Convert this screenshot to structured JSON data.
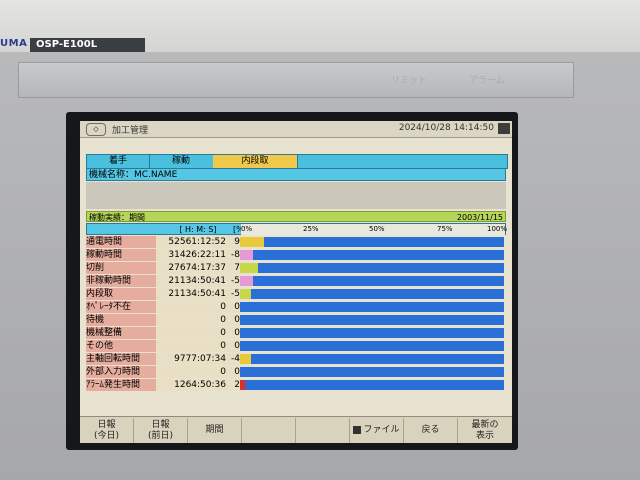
{
  "bezel": {
    "brand": "UMA",
    "model": "OSP-E100L",
    "leds": [
      "",
      "",
      "",
      "",
      "リミット",
      "アラーム"
    ]
  },
  "screen": {
    "title": "加工管理",
    "datetime": "2024/10/28 14:14:50",
    "tabs": [
      "着手",
      "稼動",
      "内段取"
    ],
    "machine_label": "機械名称：MC.NAME",
    "section_title": "稼動実績：期間",
    "section_date": "2003/11/15",
    "col_hms": "[ H: M: S]",
    "col_pct": "[%]",
    "ticks": [
      "0%",
      "25%",
      "50%",
      "75%",
      "100%"
    ],
    "rows": [
      {
        "label": "通電時間",
        "time": "52561:12:52",
        "pct": "9",
        "fill": 9,
        "color": "#e8c93a"
      },
      {
        "label": "稼動時間",
        "time": "31426:22:11",
        "pct": "-8",
        "fill": 5,
        "color": "#e59ad6"
      },
      {
        "label": "切削",
        "time": "27674:17:37",
        "pct": "7",
        "fill": 7,
        "color": "#c6d84a"
      },
      {
        "label": "非稼動時間",
        "time": "21134:50:41",
        "pct": "-5",
        "fill": 5,
        "color": "#e59ad6"
      },
      {
        "label": "内段取",
        "time": "21134:50:41",
        "pct": "-5",
        "fill": 4,
        "color": "#c6d84a"
      },
      {
        "label": "ｵﾍﾟﾚｰﾀ不在",
        "time": "0",
        "pct": "0",
        "fill": 0,
        "color": "#2a6ed7"
      },
      {
        "label": "待機",
        "time": "0",
        "pct": "0",
        "fill": 0,
        "color": "#2a6ed7"
      },
      {
        "label": "機械整備",
        "time": "0",
        "pct": "0",
        "fill": 0,
        "color": "#2a6ed7"
      },
      {
        "label": "その他",
        "time": "0",
        "pct": "0",
        "fill": 0,
        "color": "#2a6ed7"
      },
      {
        "label": "主軸回転時間",
        "time": "9777:07:34",
        "pct": "-4",
        "fill": 4,
        "color": "#e8c93a"
      },
      {
        "label": "外部入力時間",
        "time": "0",
        "pct": "0",
        "fill": 0,
        "color": "#2a6ed7"
      },
      {
        "label": "ｱﾗｰﾑ発生時間",
        "time": "1264:50:36",
        "pct": "2",
        "fill": 2,
        "color": "#d9302a"
      }
    ],
    "fkeys": [
      {
        "line1": "日報",
        "line2": "(今日)"
      },
      {
        "line1": "日報",
        "line2": "(前日)"
      },
      {
        "line1": "期間",
        "line2": ""
      },
      {
        "line1": "",
        "line2": ""
      },
      {
        "line1": "",
        "line2": ""
      },
      {
        "line1": "ファイル",
        "line2": ""
      },
      {
        "line1": "戻る",
        "line2": ""
      },
      {
        "line1": "最新の",
        "line2": "表示"
      }
    ]
  }
}
